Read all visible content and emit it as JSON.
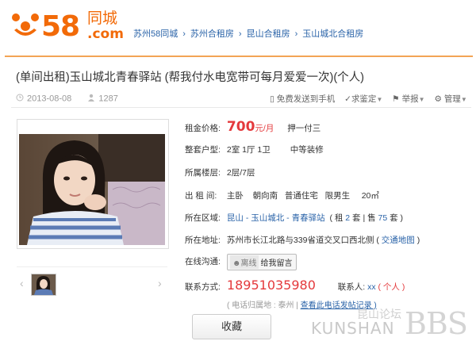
{
  "header": {
    "logo_number": "58",
    "logo_cn": "同城",
    "logo_com": ".com",
    "breadcrumbs": [
      "苏州58同城",
      "苏州合租房",
      "昆山合租房",
      "玉山城北合租房"
    ]
  },
  "listing": {
    "title": "(单间出租)玉山城北青春驿站 (帮我付水电宽带可每月爱爱一次)(个人)",
    "date": "2013-08-08",
    "views": "1287",
    "tools": {
      "send": "免费发送到手机",
      "verify": "求鉴定",
      "report": "举报",
      "manage": "管理"
    }
  },
  "details": {
    "price_label": "租金价格:",
    "price": "700",
    "price_unit": "元/月",
    "deposit": "押一付三",
    "layout_label": "整套户型:",
    "layout": "2室 1厅 1卫",
    "decoration": "中等装修",
    "floor_label": "所属楼层:",
    "floor": "2层/7层",
    "rent_label": "出 租 间:",
    "room": "主卧",
    "orientation": "朝向南",
    "house_type": "普通住宅",
    "gender": "限男生",
    "area": "20㎡",
    "region_label": "所在区域:",
    "region": "昆山 - 玉山城北 - 青春驿站",
    "region_extra_open": "( 租",
    "rent_count": "2",
    "region_mid": "套 | 售",
    "sale_count": "75",
    "region_extra_close": "套 )",
    "address_label": "所在地址:",
    "address": "苏州市长江北路与339省道交叉口西北侧",
    "map_link": "交通地图",
    "chat_label": "在线沟通:",
    "chat_offline": "离线",
    "chat_message": "给我留言",
    "contact_label": "联系方式:",
    "phone": "18951035980",
    "contact_person_label": "联系人:",
    "contact_person": "xx",
    "contact_type": "( 个人 )",
    "phone_origin": "( 电话归属地 : 泰州",
    "phone_history": "查看此电话发帖记录 )",
    "favorite": "收藏"
  },
  "watermark": {
    "latin": "KUNSHAN",
    "cn": "昆山论坛",
    "bbs": "BBS"
  },
  "colors": {
    "brand": "#f26a08",
    "link": "#2a63a8",
    "price": "#e4393c"
  }
}
